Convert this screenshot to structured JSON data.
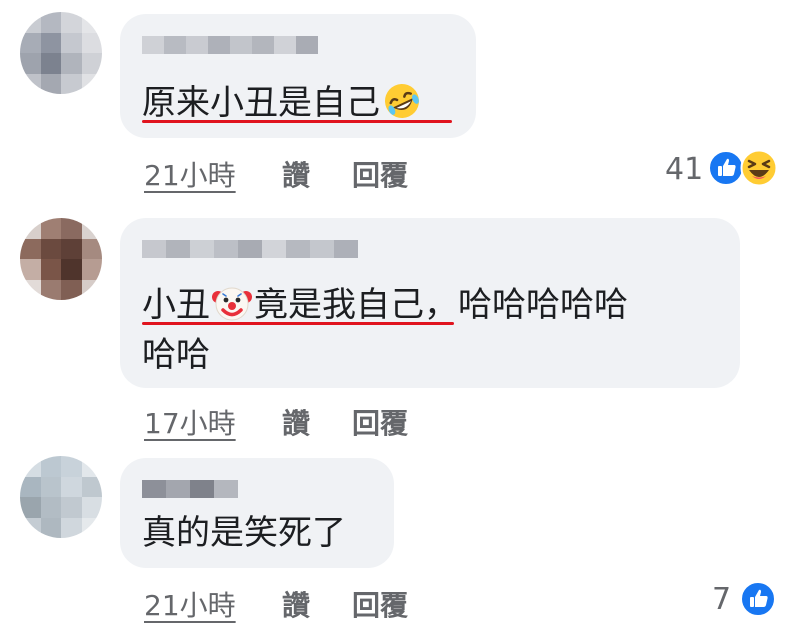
{
  "comments": [
    {
      "text": "原来小丑是自己",
      "time": "21小時",
      "like_label": "讚",
      "reply_label": "回覆",
      "reaction_count": "41",
      "reactions": [
        "like-icon",
        "laughing-icon"
      ]
    },
    {
      "text_part1": "小丑",
      "text_part2": "竟是我自己",
      "text_part3": "，哈哈哈哈哈",
      "text_line2": "哈哈",
      "time": "17小時",
      "like_label": "讚",
      "reply_label": "回覆"
    },
    {
      "text": "真的是笑死了",
      "time": "21小時",
      "like_label": "讚",
      "reply_label": "回覆",
      "reaction_count": "7",
      "reactions": [
        "like-icon"
      ]
    }
  ],
  "colors": {
    "bubble": "#f0f2f5",
    "text": "#1c1e21",
    "meta": "#65676b",
    "highlight_underline": "#e0141e",
    "like_blue": "#1877f2"
  }
}
